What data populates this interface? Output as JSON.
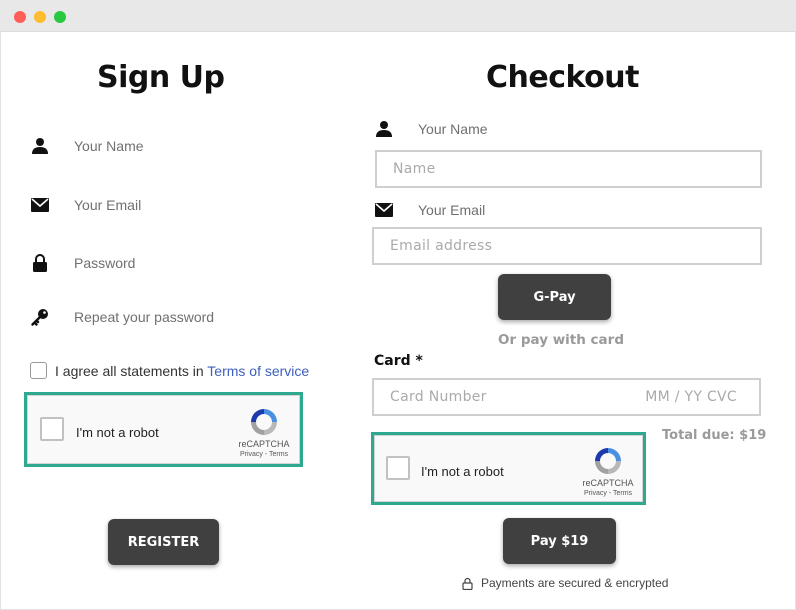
{
  "signup": {
    "title": "Sign Up",
    "fields": [
      {
        "label": "Your Name",
        "icon": "person-icon"
      },
      {
        "label": "Your Email",
        "icon": "envelope-icon"
      },
      {
        "label": "Password",
        "icon": "lock-icon"
      },
      {
        "label": "Repeat your password",
        "icon": "key-icon"
      }
    ],
    "agree_prefix": "I agree all statements in",
    "agree_link": "Terms of service",
    "recaptcha": {
      "label": "I'm not a robot",
      "brand": "reCAPTCHA",
      "links": "Privacy - Terms"
    },
    "register_label": "REGISTER"
  },
  "checkout": {
    "title": "Checkout",
    "name_label": "Your Name",
    "name_placeholder": "Name",
    "email_label": "Your Email",
    "email_placeholder": "Email address",
    "gpay_label": "G-Pay",
    "or_pay_text": "Or pay with card",
    "card_label": "Card",
    "card_required": "*",
    "card_number_placeholder": "Card Number",
    "card_expiry_placeholder": "MM / YY CVC",
    "total_due": "Total due: $19",
    "recaptcha": {
      "label": "I'm not a robot",
      "brand": "reCAPTCHA",
      "links": "Privacy - Terms"
    },
    "pay_label": "Pay $19",
    "secure_text": "Payments are secured & encrypted"
  },
  "colors": {
    "accent_border": "#2ea88e",
    "link": "#3d5fbf",
    "button": "#404040"
  }
}
